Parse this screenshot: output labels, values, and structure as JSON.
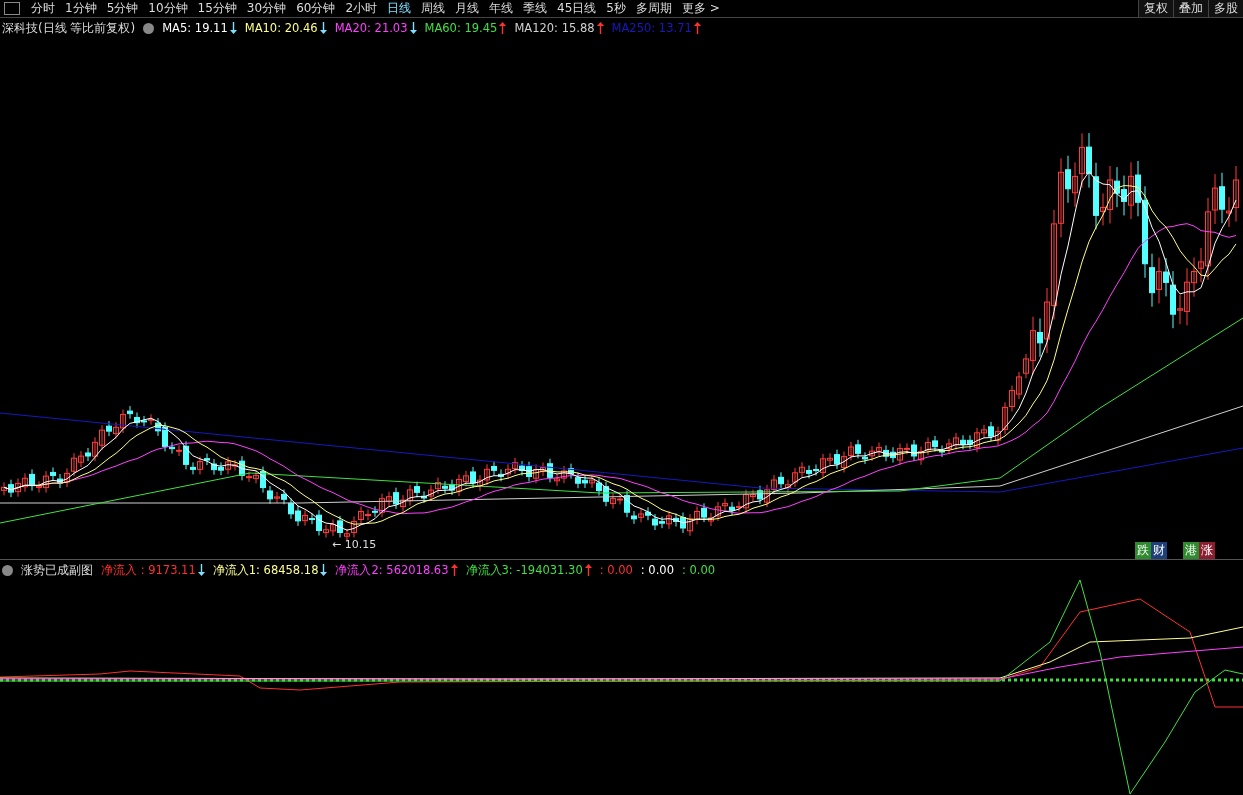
{
  "toolbar": {
    "periods": [
      {
        "label": "分时",
        "selected": false
      },
      {
        "label": "1分钟",
        "selected": false
      },
      {
        "label": "5分钟",
        "selected": false
      },
      {
        "label": "10分钟",
        "selected": false
      },
      {
        "label": "15分钟",
        "selected": false
      },
      {
        "label": "30分钟",
        "selected": false
      },
      {
        "label": "60分钟",
        "selected": false
      },
      {
        "label": "2小时",
        "selected": false
      },
      {
        "label": "日线",
        "selected": true
      },
      {
        "label": "周线",
        "selected": false
      },
      {
        "label": "月线",
        "selected": false
      },
      {
        "label": "年线",
        "selected": false
      },
      {
        "label": "季线",
        "selected": false
      },
      {
        "label": "45日线",
        "selected": false
      },
      {
        "label": "5秒",
        "selected": false
      },
      {
        "label": "多周期",
        "selected": false
      },
      {
        "label": "更多 >",
        "selected": false
      }
    ],
    "buttons": [
      "复权",
      "叠加",
      "多股"
    ]
  },
  "main_legend": {
    "title": "深科技(日线 等比前复权)",
    "indicators": [
      {
        "text": "MA5: 19.11",
        "rising": false,
        "color": "#ffffff"
      },
      {
        "text": "MA10: 20.46",
        "rising": false,
        "color": "#ffff80"
      },
      {
        "text": "MA20: 21.03",
        "rising": false,
        "color": "#ff40ff"
      },
      {
        "text": "MA60: 19.45",
        "rising": true,
        "color": "#40e040"
      },
      {
        "text": "MA120: 15.88",
        "rising": true,
        "color": "#d0d0d0"
      },
      {
        "text": "MA250: 13.71",
        "rising": true,
        "color": "#1818c0"
      }
    ]
  },
  "low_marker": "← 10.15",
  "tags": [
    {
      "label": "跌",
      "color": "#2e8b2e"
    },
    {
      "label": "财",
      "color": "#1e3f78"
    },
    {
      "label": "港",
      "color": "#2e8b2e"
    },
    {
      "label": "涨",
      "color": "#8b1e2e"
    }
  ],
  "sub_legend": {
    "title": "涨势已成副图",
    "indicators": [
      {
        "text": "净流入 : 9173.11",
        "rising": false,
        "color": "#ff3030"
      },
      {
        "text": "净流入1: 68458.18",
        "rising": false,
        "color": "#ffff90"
      },
      {
        "text": "净流入2: 562018.63",
        "rising": true,
        "color": "#ff40ff"
      },
      {
        "text": "净流入3: -194031.30",
        "rising": true,
        "color": "#40e040"
      },
      {
        "text": ": 0.00",
        "color": "#ff3030"
      },
      {
        "text": ": 0.00",
        "color": "#ffffff"
      },
      {
        "text": ": 0.00",
        "color": "#40e040"
      }
    ]
  }
}
